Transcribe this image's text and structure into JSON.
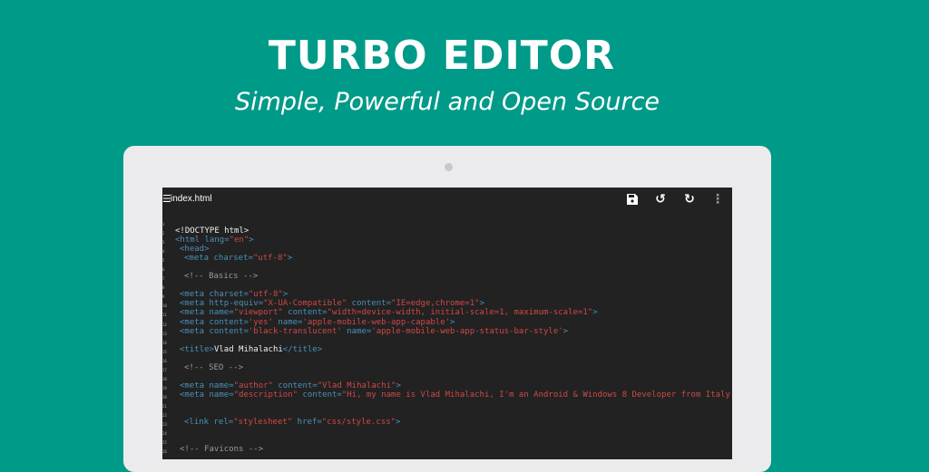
{
  "header": {
    "title": "TURBO EDITOR",
    "subtitle": "Simple, Powerful and Open Source"
  },
  "colors": {
    "background": "#009a88",
    "editor": "#222222",
    "tag": "#4a90b8",
    "string": "#d04848",
    "comment": "#9a9a9a"
  },
  "editor": {
    "menu_icon": "☰",
    "filename": "index.html",
    "toolbar": [
      {
        "name": "save-icon",
        "glyph": "💾"
      },
      {
        "name": "undo-icon",
        "glyph": "↺"
      },
      {
        "name": "redo-icon",
        "glyph": "↻"
      },
      {
        "name": "more-icon",
        "glyph": "⋮"
      }
    ],
    "lines": [
      {
        "n": "1",
        "indent": 0,
        "tokens": []
      },
      {
        "n": "2",
        "indent": 0,
        "tokens": [
          [
            "x",
            "<!DOCTYPE html>"
          ]
        ]
      },
      {
        "n": "3",
        "indent": 0,
        "tokens": [
          [
            "t",
            "<html "
          ],
          [
            "a",
            "lang="
          ],
          [
            "s",
            "\"en\""
          ],
          [
            "t",
            ">"
          ]
        ]
      },
      {
        "n": "4",
        "indent": 1,
        "tokens": [
          [
            "t",
            "<head>"
          ]
        ]
      },
      {
        "n": "5",
        "indent": 2,
        "tokens": [
          [
            "t",
            "<meta "
          ],
          [
            "a",
            "charset="
          ],
          [
            "s",
            "\"utf-8\""
          ],
          [
            "t",
            ">"
          ]
        ]
      },
      {
        "n": "6",
        "indent": 0,
        "tokens": []
      },
      {
        "n": "7",
        "indent": 2,
        "tokens": [
          [
            "c",
            "<!-- Basics -->"
          ]
        ]
      },
      {
        "n": "8",
        "indent": 0,
        "tokens": []
      },
      {
        "n": "9",
        "indent": 1,
        "tokens": [
          [
            "t",
            "<meta "
          ],
          [
            "a",
            "charset="
          ],
          [
            "s",
            "\"utf-8\""
          ],
          [
            "t",
            ">"
          ]
        ]
      },
      {
        "n": "10",
        "indent": 1,
        "tokens": [
          [
            "t",
            "<meta "
          ],
          [
            "a",
            "http-equiv="
          ],
          [
            "s",
            "\"X-UA-Compatible\""
          ],
          [
            "a",
            " content="
          ],
          [
            "s",
            "\"IE=edge,chrome=1\""
          ],
          [
            "t",
            ">"
          ]
        ]
      },
      {
        "n": "11",
        "indent": 1,
        "tokens": [
          [
            "t",
            "<meta "
          ],
          [
            "a",
            "name="
          ],
          [
            "s",
            "\"viewport\""
          ],
          [
            "a",
            " content="
          ],
          [
            "s",
            "\"width=device-width, initial-scale=1, maximum-scale=1\""
          ],
          [
            "t",
            ">"
          ]
        ]
      },
      {
        "n": "12",
        "indent": 1,
        "tokens": [
          [
            "t",
            "<meta "
          ],
          [
            "a",
            "content="
          ],
          [
            "s",
            "'yes'"
          ],
          [
            "a",
            " name="
          ],
          [
            "s",
            "'apple-mobile-web-app-capable'"
          ],
          [
            "t",
            ">"
          ]
        ]
      },
      {
        "n": "13",
        "indent": 1,
        "tokens": [
          [
            "t",
            "<meta "
          ],
          [
            "a",
            "content="
          ],
          [
            "s",
            "'black-translucent'"
          ],
          [
            "a",
            " name="
          ],
          [
            "s",
            "'apple-mobile-web-app-status-bar-style'"
          ],
          [
            "t",
            ">"
          ]
        ]
      },
      {
        "n": "14",
        "indent": 0,
        "tokens": []
      },
      {
        "n": "15",
        "indent": 1,
        "tokens": [
          [
            "t",
            "<title>"
          ],
          [
            "x",
            "Vlad Mihalachi"
          ],
          [
            "t",
            "</title>"
          ]
        ]
      },
      {
        "n": "16",
        "indent": 0,
        "tokens": []
      },
      {
        "n": "17",
        "indent": 2,
        "tokens": [
          [
            "c",
            "<!-- SEO -->"
          ]
        ]
      },
      {
        "n": "18",
        "indent": 0,
        "tokens": []
      },
      {
        "n": "19",
        "indent": 1,
        "tokens": [
          [
            "t",
            "<meta "
          ],
          [
            "a",
            "name="
          ],
          [
            "s",
            "\"author\""
          ],
          [
            "a",
            " content="
          ],
          [
            "s",
            "\"Vlad Mihalachi\""
          ],
          [
            "t",
            ">"
          ]
        ]
      },
      {
        "n": "20",
        "indent": 1,
        "tokens": [
          [
            "t",
            "<meta "
          ],
          [
            "a",
            "name="
          ],
          [
            "s",
            "\"description\""
          ],
          [
            "a",
            " content="
          ],
          [
            "s",
            "\"Hi, my name is Vlad Mihalachi, I'm an Android & Windows 8 Developer from Italy."
          ]
        ]
      },
      {
        "n": "21",
        "indent": 0,
        "tokens": []
      },
      {
        "n": "22",
        "indent": 0,
        "tokens": []
      },
      {
        "n": "23",
        "indent": 2,
        "tokens": [
          [
            "t",
            "<link "
          ],
          [
            "a",
            "rel="
          ],
          [
            "s",
            "\"stylesheet\""
          ],
          [
            "a",
            " href="
          ],
          [
            "s",
            "\"css/style.css\""
          ],
          [
            "t",
            ">"
          ]
        ]
      },
      {
        "n": "24",
        "indent": 0,
        "tokens": []
      },
      {
        "n": "25",
        "indent": 0,
        "tokens": []
      },
      {
        "n": "26",
        "indent": 1,
        "tokens": [
          [
            "c",
            "<!-- Favicons -->"
          ]
        ]
      }
    ]
  }
}
